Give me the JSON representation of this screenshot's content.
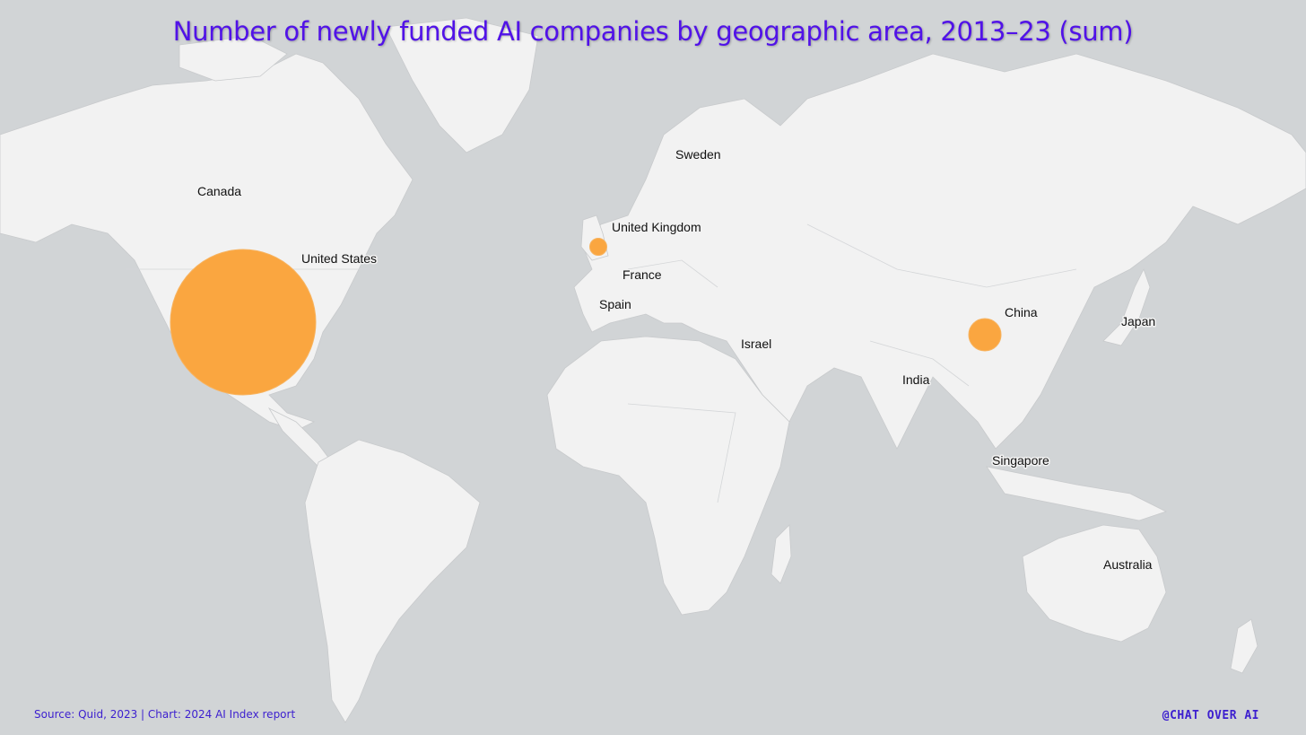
{
  "title": "Number of newly funded AI companies by geographic area, 2013–23 (sum)",
  "source": "Source: Quid, 2023 | Chart: 2024 AI Index report",
  "brand": "@CHAT OVER AI",
  "colors": {
    "ocean": "#d1d4d6",
    "land": "#f2f2f2",
    "bubble": "#faa640",
    "title": "#5112e8",
    "footer": "#3c1fcf"
  },
  "labels": {
    "canada": "Canada",
    "united_states": "United States",
    "sweden": "Sweden",
    "united_kingdom": "United Kingdom",
    "france": "France",
    "spain": "Spain",
    "israel": "Israel",
    "china": "China",
    "japan": "Japan",
    "india": "India",
    "singapore": "Singapore",
    "australia": "Australia"
  },
  "chart_data": {
    "type": "bubble-map",
    "title": "Number of newly funded AI companies by geographic area, 2013–23 (sum)",
    "note": "bubble size proportional to count; exact counts not printed",
    "bubbles": [
      {
        "country": "United States",
        "relative_size": 1.0
      },
      {
        "country": "China",
        "relative_size": 0.22
      },
      {
        "country": "United Kingdom",
        "relative_size": 0.12
      }
    ]
  }
}
